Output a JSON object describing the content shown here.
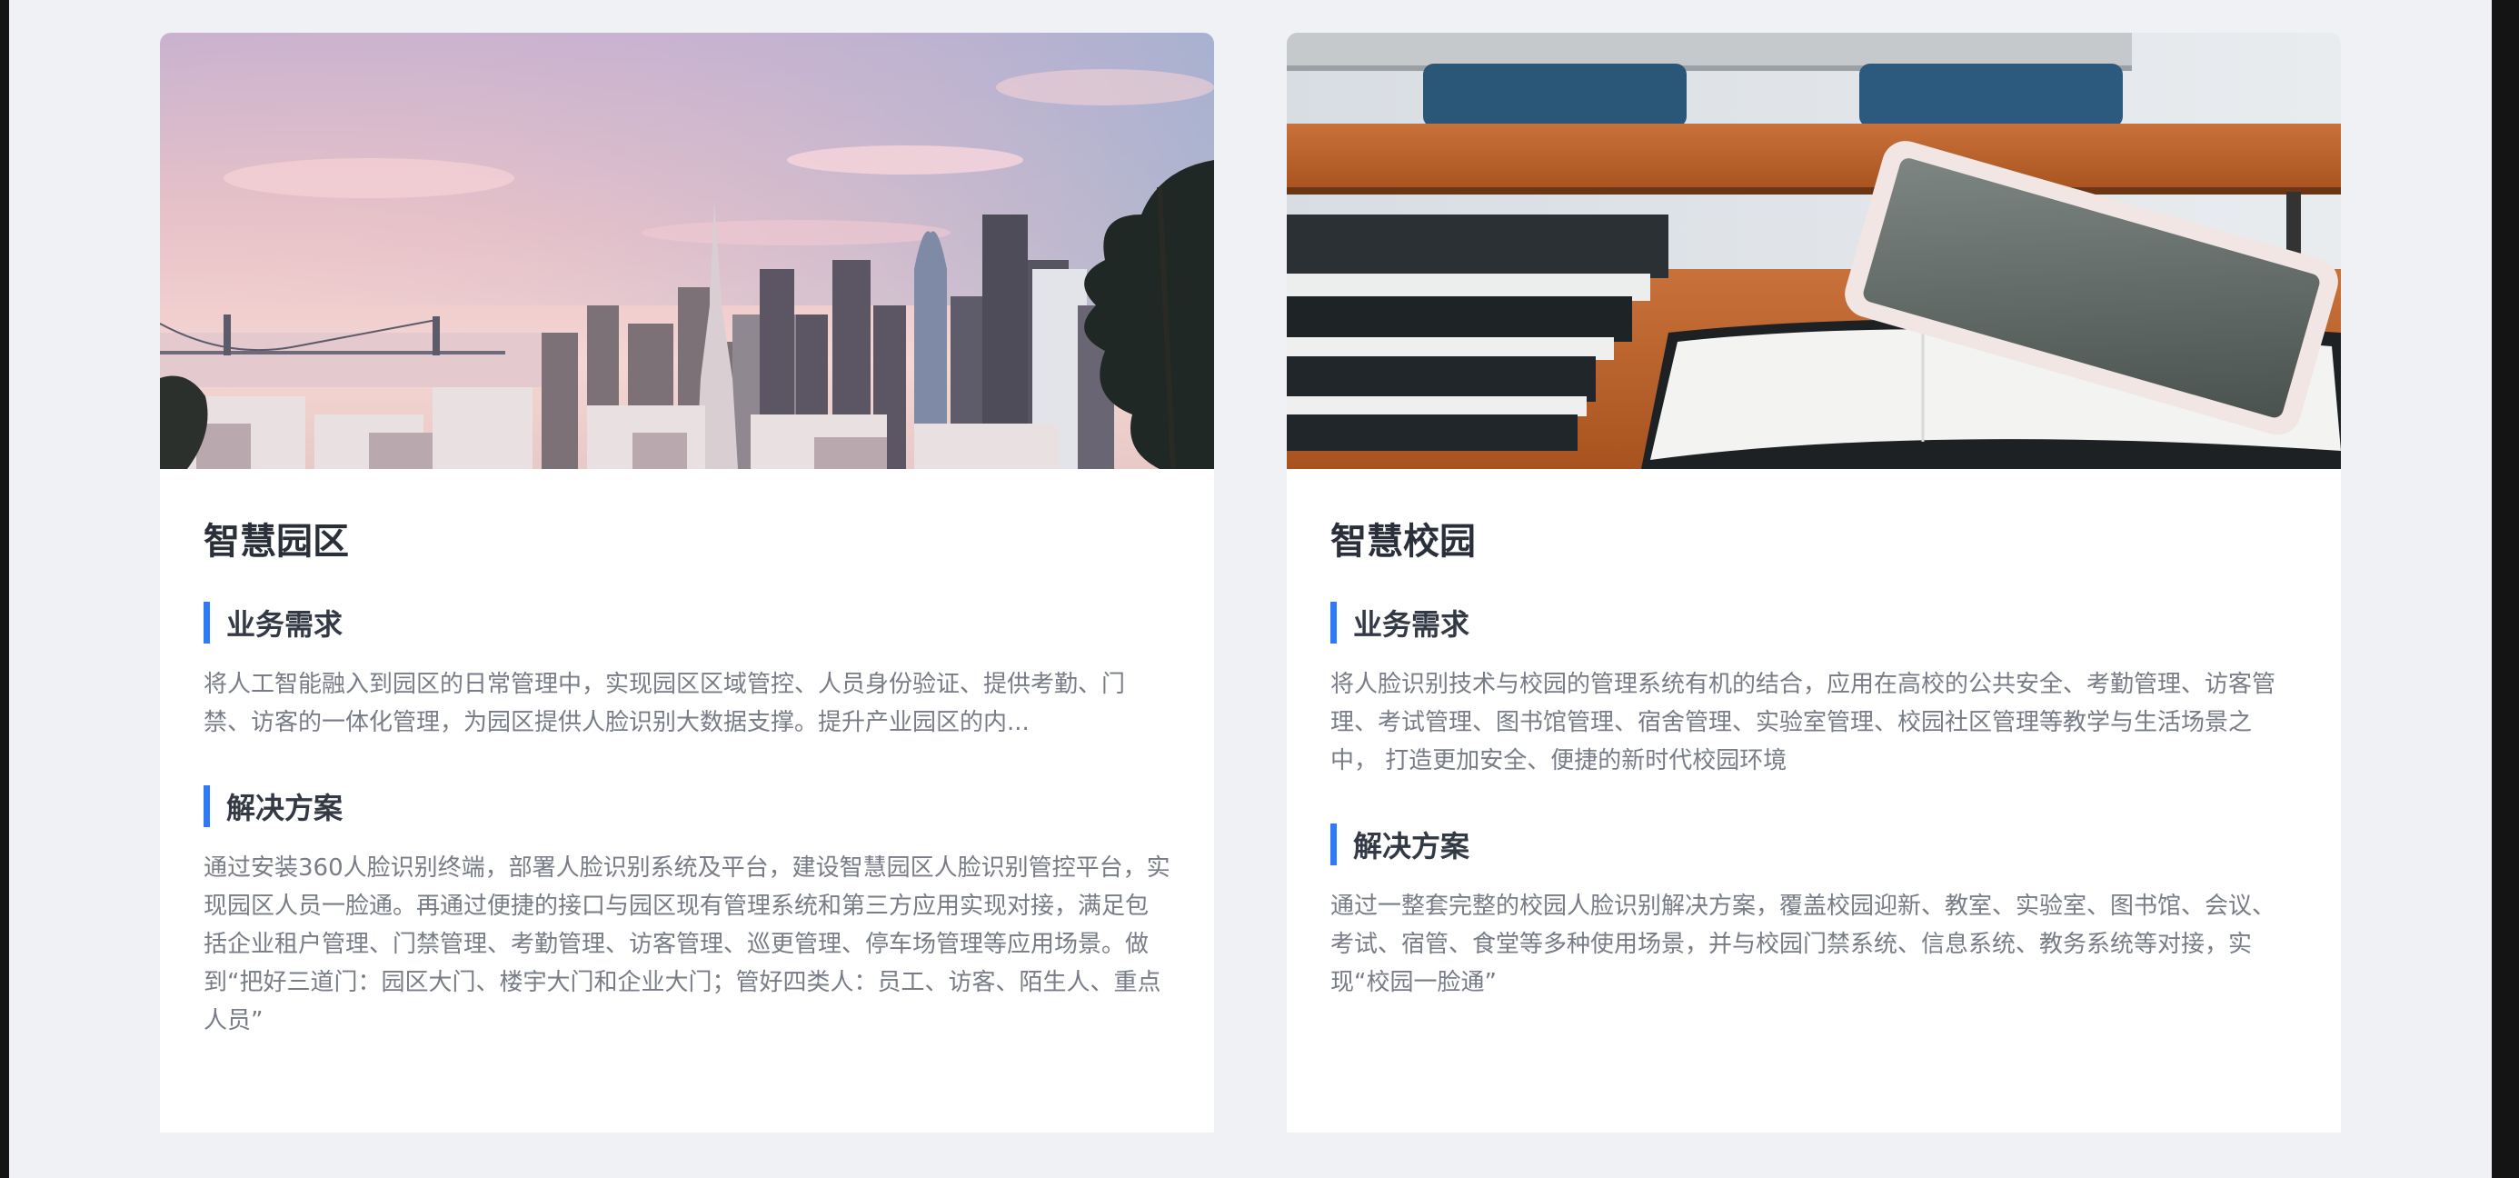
{
  "cards": [
    {
      "title": "智慧园区",
      "image_alt": "city skyline at sunset",
      "sections": [
        {
          "label": "业务需求",
          "text": "将人工智能融入到园区的日常管理中，实现园区区域管控、人员身份验证、提供考勤、门禁、访客的一体化管理，为园区提供人脸识别大数据支撑。提升产业园区的内..."
        },
        {
          "label": "解决方案",
          "text": "通过安装360人脸识别终端，部署人脸识别系统及平台，建设智慧园区人脸识别管控平台，实现园区人员一脸通。再通过便捷的接口与园区现有管理系统和第三方应用实现对接，满足包括企业租户管理、门禁管理、考勤管理、访客管理、巡更管理、停车场管理等应用场景。做到“把好三道门：园区大门、楼宇大门和企业大门；管好四类人：员工、访客、陌生人、重点人员”"
        }
      ]
    },
    {
      "title": "智慧校园",
      "image_alt": "books and tablet on desk",
      "sections": [
        {
          "label": "业务需求",
          "text": "将人脸识别技术与校园的管理系统有机的结合，应用在高校的公共安全、考勤管理、访客管理、考试管理、图书馆管理、宿舍管理、实验室管理、校园社区管理等教学与生活场景之中， 打造更加安全、便捷的新时代校园环境"
        },
        {
          "label": "解决方案",
          "text": "通过一整套完整的校园人脸识别解决方案，覆盖校园迎新、教室、实验室、图书馆、会议、考试、宿管、食堂等多种使用场景，并与校园门禁系统、信息系统、教务系统等对接，实现“校园一脸通”"
        }
      ]
    }
  ],
  "colors": {
    "accent": "#2f7bf5",
    "page_bg": "#eff1f5",
    "card_bg": "#ffffff",
    "title_text": "#2a2f3a",
    "body_text": "#777c86"
  }
}
